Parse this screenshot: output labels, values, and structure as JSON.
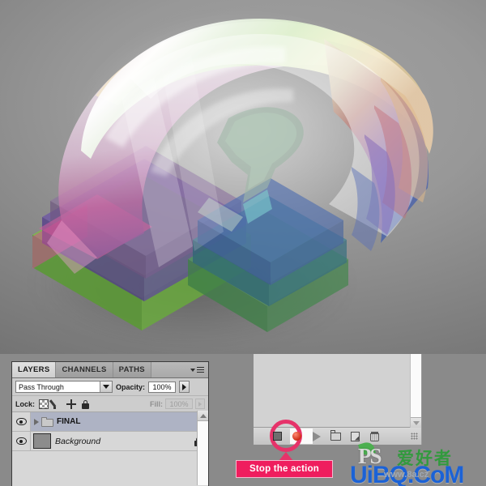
{
  "artwork": {
    "description": "3D isometric translucent glass question mark with iridescent rainbow layers",
    "background_color": "#8a8a8a",
    "palette": [
      "#f0c8e0",
      "#c94f8e",
      "#7b4fb0",
      "#5f7fc8",
      "#4fa8a8",
      "#7cc043",
      "#e8d79a",
      "#ffffff"
    ]
  },
  "layers_panel": {
    "tabs": [
      {
        "label": "LAYERS",
        "active": true
      },
      {
        "label": "CHANNELS",
        "active": false
      },
      {
        "label": "PATHS",
        "active": false
      }
    ],
    "menu_icon": "panel-menu-icon",
    "blend_mode": "Pass Through",
    "opacity_label": "Opacity:",
    "opacity_value": "100%",
    "lock_label": "Lock:",
    "lock_icons": [
      "lock-transparency-icon",
      "lock-image-icon",
      "lock-position-icon",
      "lock-all-icon"
    ],
    "fill_label": "Fill:",
    "fill_value": "100%",
    "layers": [
      {
        "name": "FINAL",
        "type": "group",
        "visible": true,
        "selected": true,
        "locked": false
      },
      {
        "name": "Background",
        "type": "layer",
        "visible": true,
        "selected": false,
        "locked": true
      }
    ]
  },
  "actions_panel": {
    "buttons": [
      {
        "name": "stop-button",
        "label": "Stop",
        "highlighted": true
      },
      {
        "name": "record-button",
        "label": "Begin recording"
      },
      {
        "name": "play-button",
        "label": "Play selection"
      },
      {
        "name": "new-set-button",
        "label": "Create new set"
      },
      {
        "name": "new-action-button",
        "label": "Create new action"
      },
      {
        "name": "delete-button",
        "label": "Delete"
      }
    ]
  },
  "annotation": {
    "label": "Stop the action",
    "label_bg": "#ef1d5e",
    "label_color": "#ffffff",
    "highlight_color": "#e6336a"
  },
  "watermark": {
    "ps": "PS",
    "chinese": "爱好者",
    "main": "UiBQ.CoM",
    "small": "www.8a.cz"
  }
}
